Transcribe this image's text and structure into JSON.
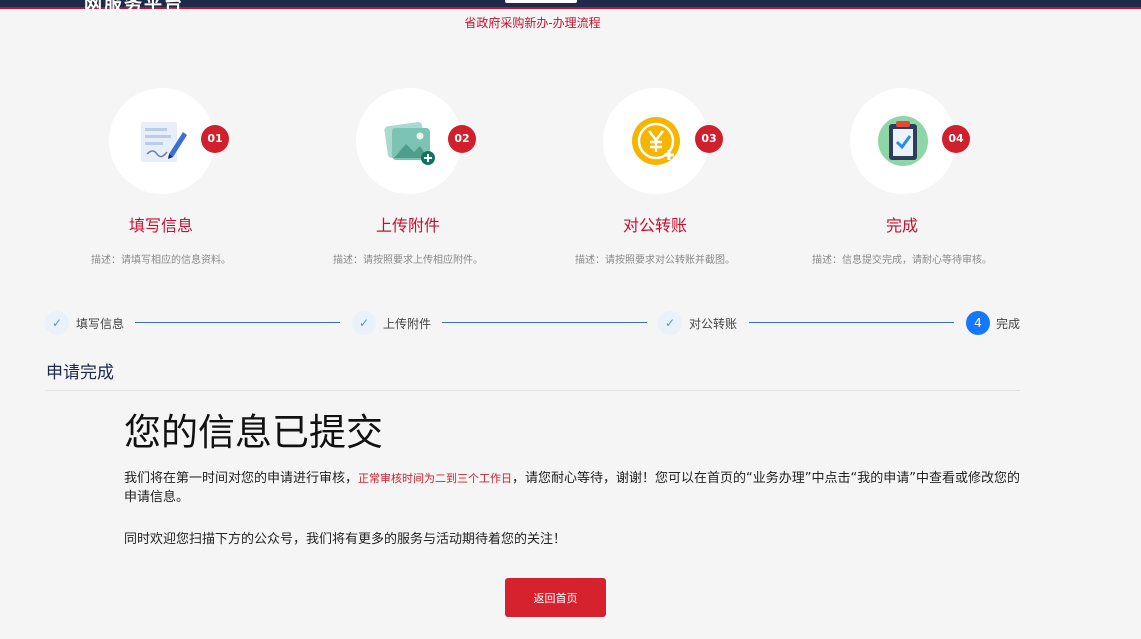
{
  "header": {
    "logo_fragment": "网服务平台",
    "page_title": "省政府采购新办-办理流程"
  },
  "steps": [
    {
      "badge": "01",
      "name": "填写信息",
      "desc": "描述：请填写相应的信息资料。",
      "icon": "form-icon"
    },
    {
      "badge": "02",
      "name": "上传附件",
      "desc": "描述：请按照要求上传相应附件。",
      "icon": "upload-image-icon"
    },
    {
      "badge": "03",
      "name": "对公转账",
      "desc": "描述：请按照要求对公转账并截图。",
      "icon": "yuan-coin-icon"
    },
    {
      "badge": "04",
      "name": "完成",
      "desc": "描述：信息提交完成，请耐心等待审核。",
      "icon": "clipboard-check-icon"
    }
  ],
  "progress": [
    {
      "mark": "✓",
      "label": "填写信息",
      "status": "done"
    },
    {
      "mark": "✓",
      "label": "上传附件",
      "status": "done"
    },
    {
      "mark": "✓",
      "label": "对公转账",
      "status": "done"
    },
    {
      "mark": "4",
      "label": "完成",
      "status": "active"
    }
  ],
  "main": {
    "section_title": "申请完成",
    "heading": "您的信息已提交",
    "msg_part1": "我们将在第一时间对您的申请进行审核，",
    "msg_highlight": "正常审核时间为二到三个工作日",
    "msg_part2": "，请您耐心等待，谢谢！您可以在首页的“业务办理”中点击“我的申请”中查看或修改您的申请信息。",
    "msg_second": "同时欢迎您扫描下方的公众号，我们将有更多的服务与活动期待着您的关注！",
    "home_button": "返回首页"
  },
  "colors": {
    "accent": "#c8102e",
    "button": "#d6212e",
    "active_step": "#1677ff",
    "navy": "#1e2a4a"
  }
}
